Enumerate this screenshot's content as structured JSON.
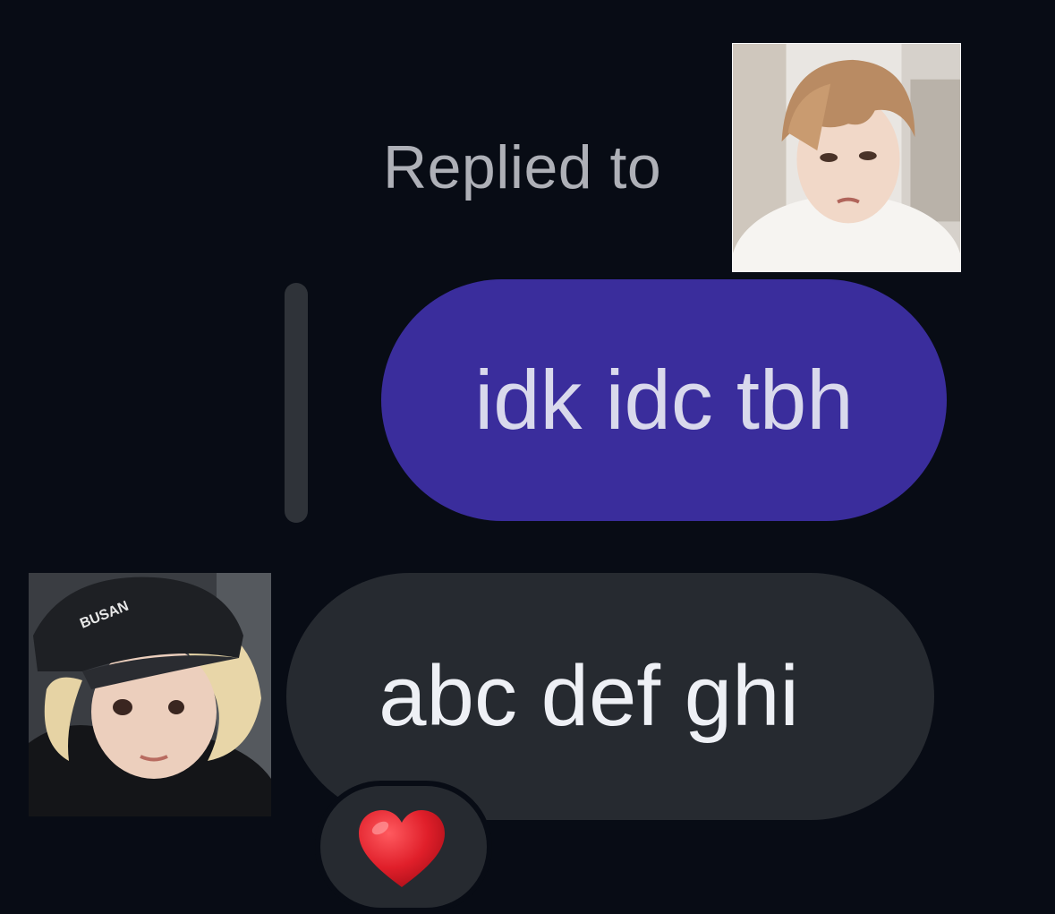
{
  "reply": {
    "header": "Replied to"
  },
  "messages": [
    {
      "text": "idk idc tbh",
      "kind": "sent"
    },
    {
      "text": "abc def ghi",
      "kind": "received"
    }
  ],
  "reaction": {
    "icon": "heart-emoji",
    "color": "#e01f2a"
  },
  "avatars": {
    "top_cap_text": "",
    "left_cap_text": "BUSAN"
  },
  "colors": {
    "background": "#080c15",
    "sent_bubble": "#3a2d9c",
    "received_bubble": "#262a30",
    "reply_bar": "#2f3339"
  }
}
